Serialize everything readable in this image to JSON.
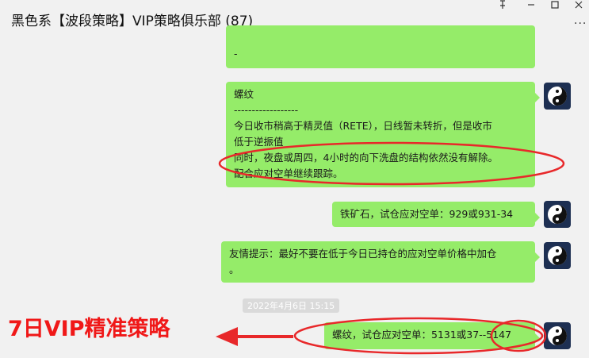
{
  "window": {
    "title": "黑色系【波段策略】VIP策略俱乐部  (87)",
    "pin_icon": "pin-icon",
    "minimize_icon": "minimize-icon",
    "maximize_icon": "maximize-icon",
    "close_icon": "close-icon",
    "more_icon": "more-icon"
  },
  "messages": [
    {
      "lines": [
        "...",
        "-"
      ]
    },
    {
      "lines": [
        "螺纹",
        "------------------",
        "今日收市稍高于精灵值（RETE），日线暂未转折，但是收市",
        "低于逆振值",
        "同时，夜盘或周四，4小时的向下洗盘的结构依然没有解除。",
        "配合应对空单继续跟踪。"
      ]
    },
    {
      "lines": [
        "铁矿石，试仓应对空单：929或931-34"
      ]
    },
    {
      "lines": [
        "友情提示：最好不要在低于今日已持仓的应对空单价格中加仓",
        "。"
      ]
    },
    {
      "lines": [
        "螺纹，试仓应对空单：5131或37--5147"
      ]
    }
  ],
  "timestamp": "2022年4月6日 15:15",
  "annotation": {
    "promo_text": "7日VIP精准策略",
    "color": "#f01818"
  },
  "colors": {
    "bubble": "#95ec69",
    "background": "#f1f1f1",
    "annotation": "#e8282a"
  }
}
